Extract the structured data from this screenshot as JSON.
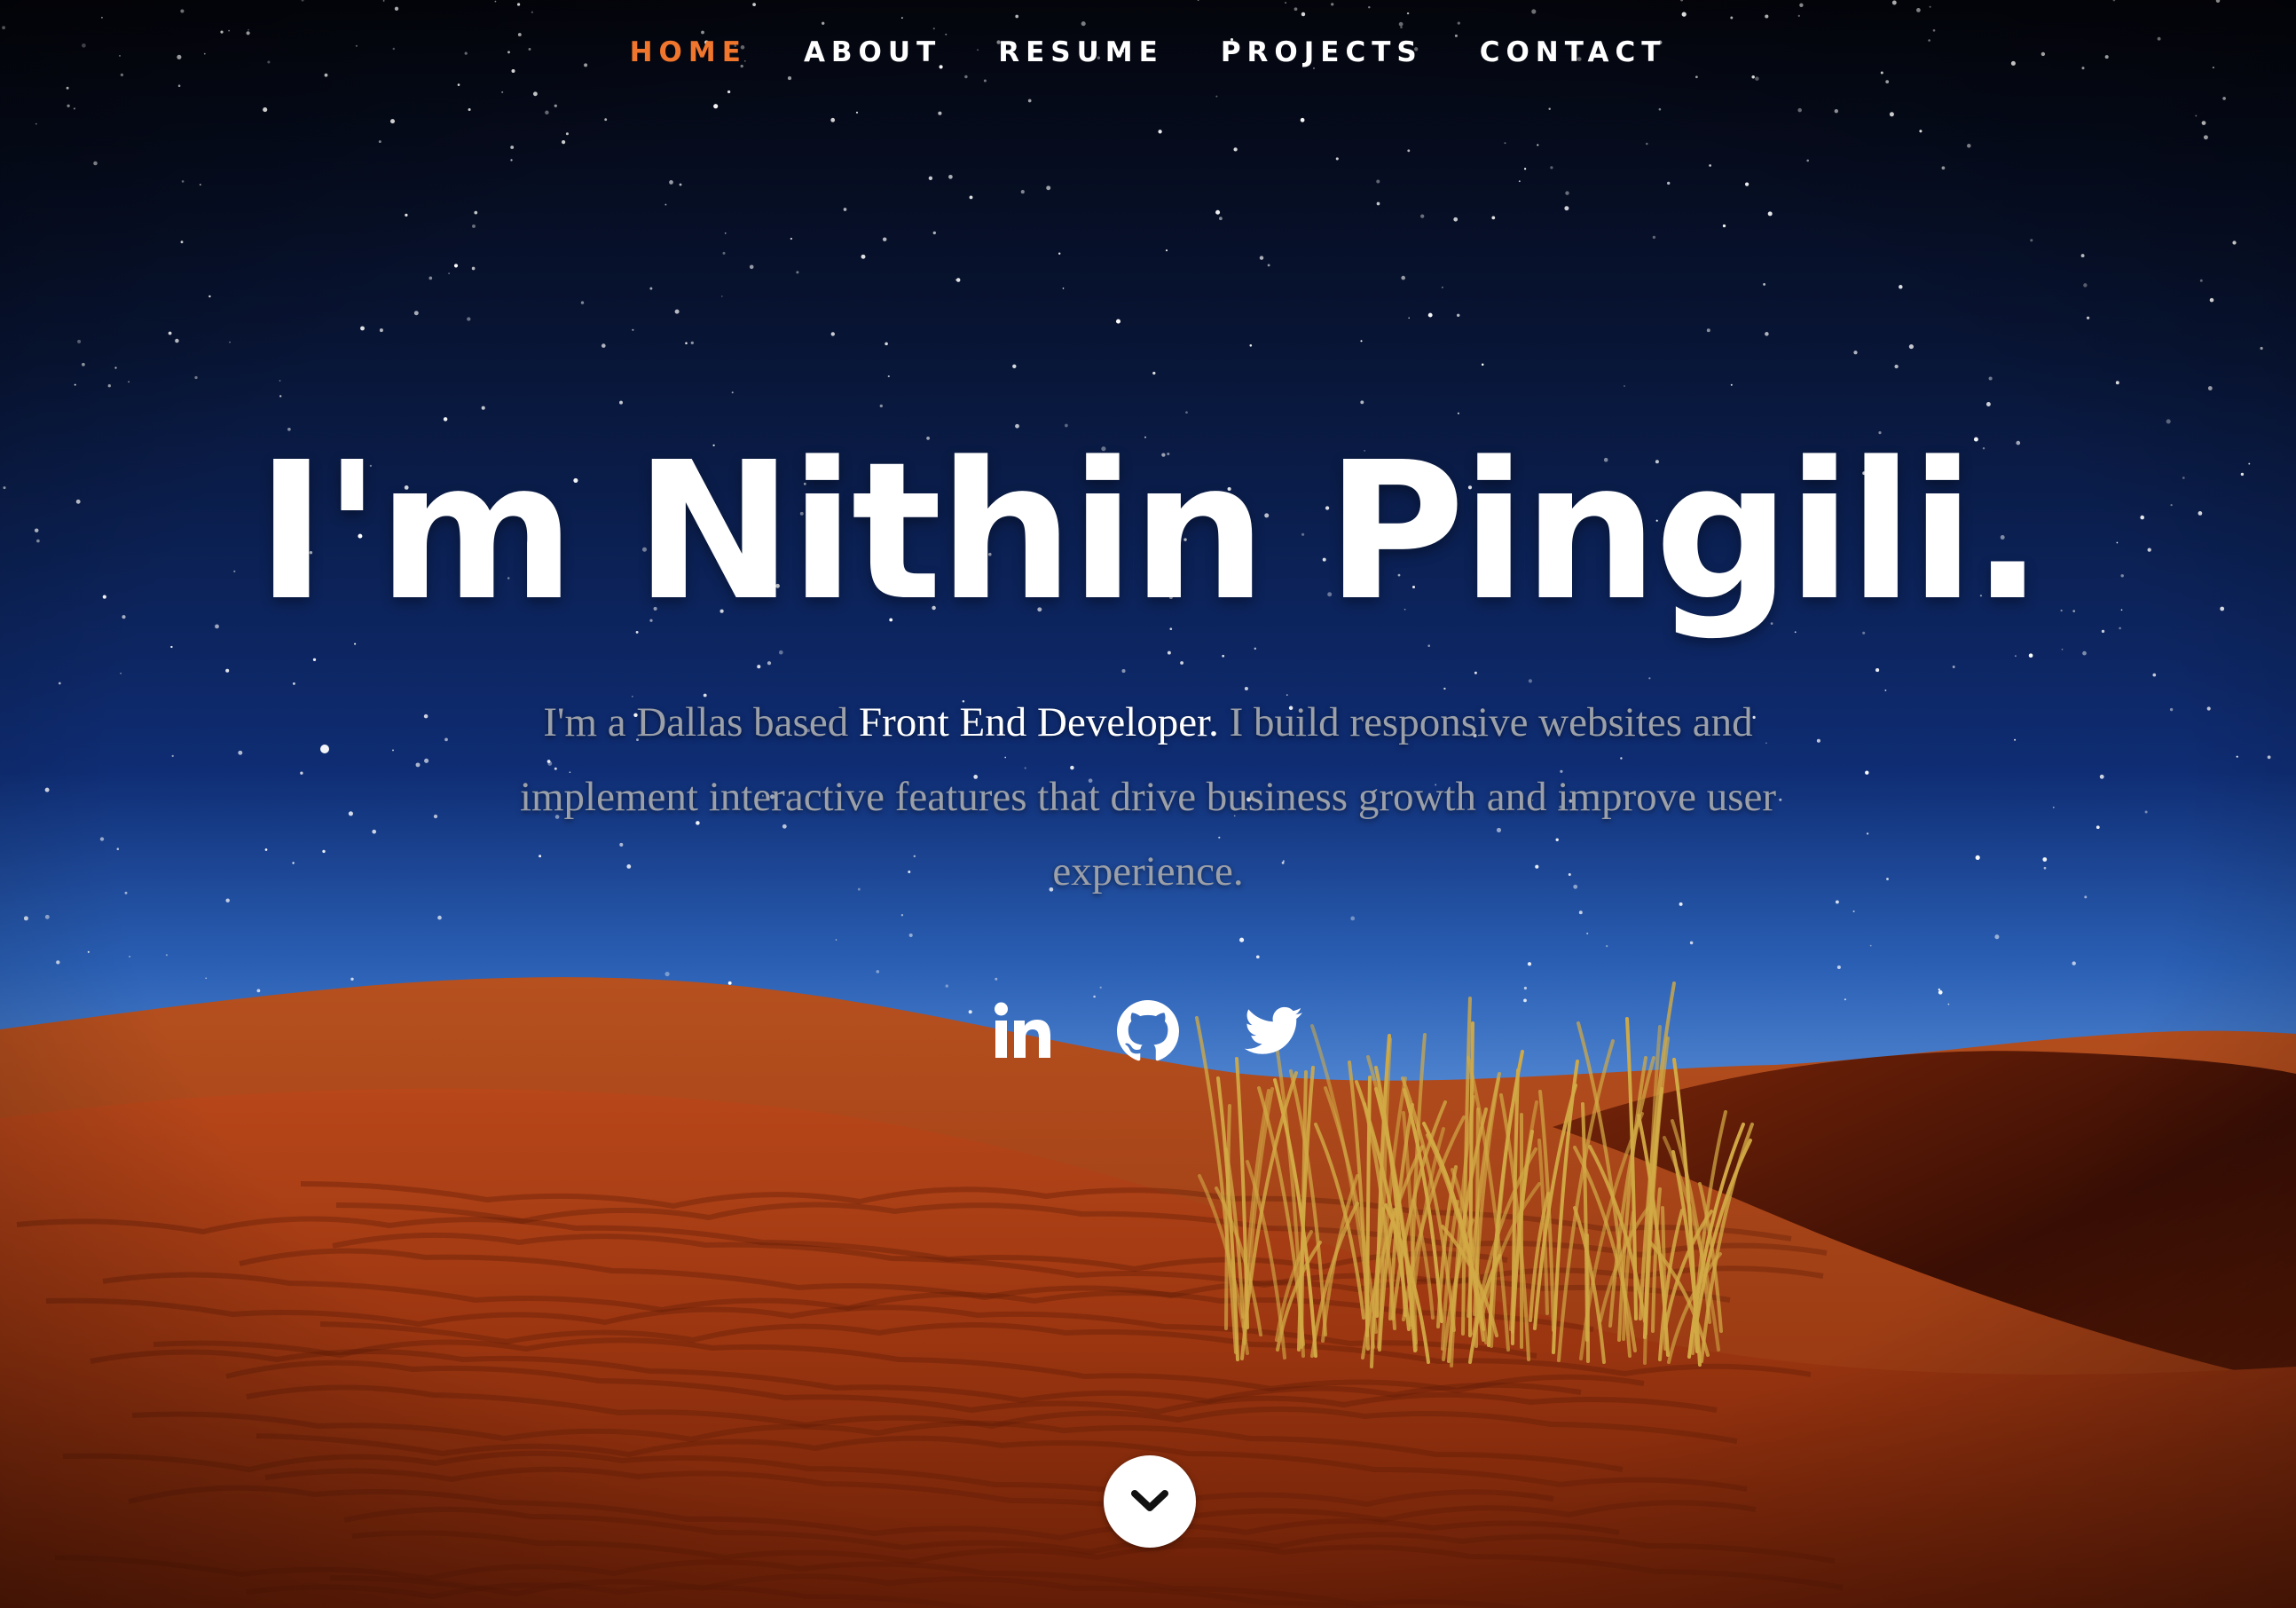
{
  "nav": {
    "items": [
      {
        "label": "HOME",
        "active": true
      },
      {
        "label": "ABOUT",
        "active": false
      },
      {
        "label": "RESUME",
        "active": false
      },
      {
        "label": "PROJECTS",
        "active": false
      },
      {
        "label": "CONTACT",
        "active": false
      }
    ],
    "active_color": "#f0752d"
  },
  "hero": {
    "title": "I'm Nithin Pingili.",
    "intro_prefix": "I'm a Dallas based ",
    "intro_highlight": "Front End Developer.",
    "intro_suffix": " I build responsive websites and implement interactive features that drive business growth and improve user experience."
  },
  "social": {
    "items": [
      {
        "icon": "linkedin-icon"
      },
      {
        "icon": "github-icon"
      },
      {
        "icon": "twitter-icon"
      }
    ]
  },
  "scroll": {
    "icon": "chevron-down-icon"
  },
  "colors": {
    "sky_top": "#05060f",
    "sky_mid": "#0e2a6e",
    "sky_horizon": "#3e7fd4",
    "sand_light": "#c2501c",
    "sand_dark": "#4a1406",
    "grass": "#c9a13a",
    "accent": "#f0752d"
  }
}
